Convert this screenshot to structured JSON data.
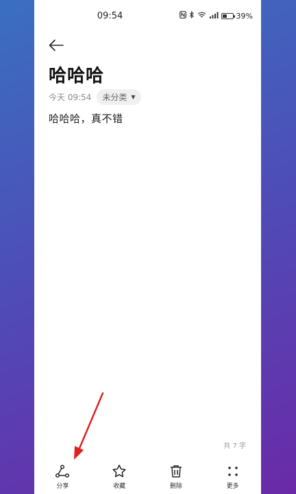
{
  "status_bar": {
    "time": "09:54",
    "battery": "39%",
    "battery_level": 0.39,
    "icons": [
      "nfc-icon",
      "bluetooth-icon",
      "wifi-icon",
      "signal-icon",
      "battery-icon"
    ]
  },
  "note": {
    "title": "哈哈哈",
    "timestamp": "今天 09:54",
    "category": "未分类",
    "body": "哈哈哈，真不错",
    "word_count": "共 7 字"
  },
  "toolbar": {
    "share_label": "分享",
    "favorite_label": "收藏",
    "delete_label": "删除",
    "more_label": "更多"
  },
  "colors": {
    "annotation_arrow": "#e02020",
    "background_gradient_start": "#3a6fc0",
    "background_gradient_end": "#6a2aa8"
  }
}
